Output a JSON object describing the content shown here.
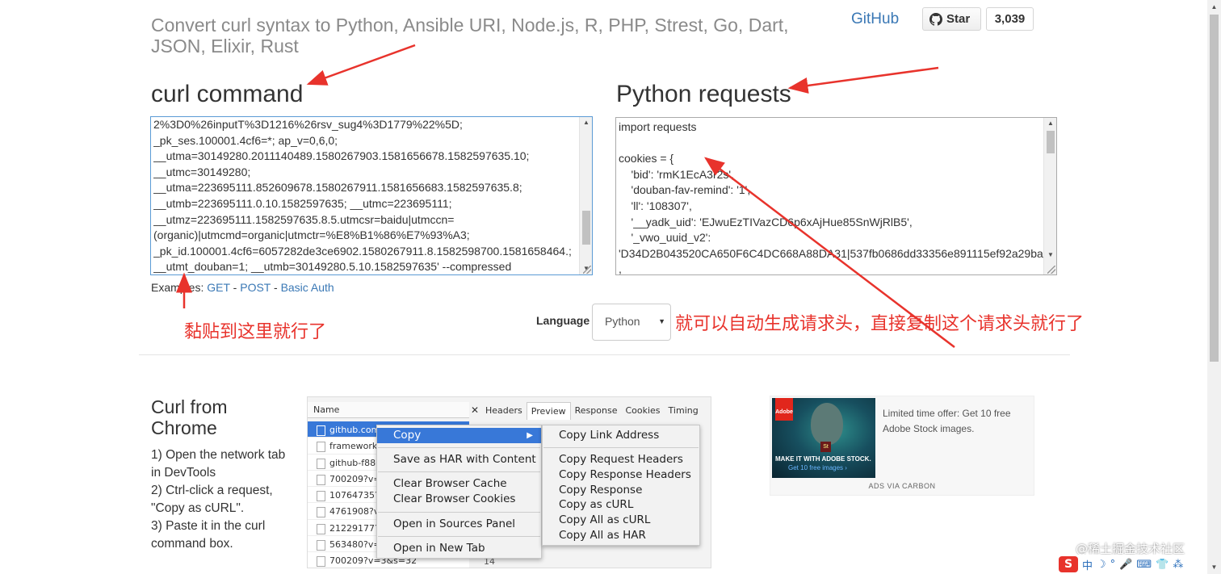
{
  "header": {
    "headline": "Convert curl syntax to Python, Ansible URI, Node.js, R, PHP, Strest, Go, Dart, JSON, Elixir, Rust",
    "github_link": "GitHub",
    "star_label": "Star",
    "star_count": "3,039"
  },
  "curl_section": {
    "title": "curl command",
    "lines": [
      "2%3D0%26inputT%3D1216%26rsv_sug4%3D1779%22%5D;",
      "_pk_ses.100001.4cf6=*; ap_v=0,6,0;",
      "__utma=30149280.2011140489.1580267903.1581656678.1582597635.10;",
      "__utmc=30149280;",
      "__utma=223695111.852609678.1580267911.1581656683.1582597635.8;",
      "__utmb=223695111.0.10.1582597635; __utmc=223695111;",
      "__utmz=223695111.1582597635.8.5.utmcsr=baidu|utmccn=",
      "(organic)|utmcmd=organic|utmctr=%E8%B1%86%E7%93%A3;",
      "_pk_id.100001.4cf6=6057282de3ce6902.1580267911.8.1582598700.1581658464.;",
      "__utmt_douban=1; __utmb=30149280.5.10.1582597635' --compressed"
    ]
  },
  "examples": {
    "label": "Examples:",
    "get": "GET",
    "post": "POST",
    "basic_auth": "Basic Auth",
    "sep": " - "
  },
  "python_section": {
    "title": "Python requests",
    "lines": [
      "import requests",
      "",
      "cookies = {",
      "    'bid': 'rmK1EcA3r2s',",
      "    'douban-fav-remind': '1',",
      "    'll': '108307',",
      "    '__yadk_uid': 'EJwuEzTIVazCD6p6xAjHue85SnWjRlB5',",
      "    '_vwo_uuid_v2':",
      "'D34D2B043520CA650F6C4DC668A88DA31|537fb0686dd33356e891115ef92a29ba'",
      ","
    ]
  },
  "language": {
    "label": "Language",
    "selected": "Python"
  },
  "annotations": {
    "paste_here": "黏贴到这里就行了",
    "auto_generate": "就可以自动生成请求头，直接复制这个请求头就行了",
    "color": "#e8332c"
  },
  "chrome_section": {
    "title": "Curl from Chrome",
    "step1": "1) Open the network tab in DevTools",
    "step2": "2) Ctrl-click a request, \"Copy as cURL\".",
    "step3": "3) Paste it in the curl command box."
  },
  "devtools": {
    "name_header": "Name",
    "tabs": [
      "Headers",
      "Preview",
      "Response",
      "Cookies",
      "Timing"
    ],
    "rows": [
      "github.com",
      "frameworks-",
      "github-f886",
      "700209?v=3",
      "10764735?v",
      "4761908?v=",
      "21229177?v",
      "563480?v=3",
      "700209?v=3&s=32"
    ],
    "row_count": "14",
    "menu": [
      "Copy",
      "Save as HAR with Content",
      "Clear Browser Cache",
      "Clear Browser Cookies",
      "Open in Sources Panel",
      "Open in New Tab"
    ],
    "submenu": [
      "Copy Link Address",
      "Copy Request Headers",
      "Copy Response Headers",
      "Copy Response",
      "Copy as cURL",
      "Copy All as cURL",
      "Copy All as HAR"
    ]
  },
  "ad": {
    "logo": "Adobe",
    "badge": "St",
    "caption1": "MAKE IT WITH ADOBE STOCK.",
    "caption2": "Get 10 free images ›",
    "text": "Limited time offer: Get 10 free Adobe Stock images.",
    "via": "ADS VIA CARBON"
  },
  "watermark": "@稀土掘金技术社区",
  "ime": {
    "logo": "S",
    "items": [
      "中",
      "☽",
      "°",
      "🎤",
      "⌨",
      "👕",
      "⁂"
    ]
  }
}
